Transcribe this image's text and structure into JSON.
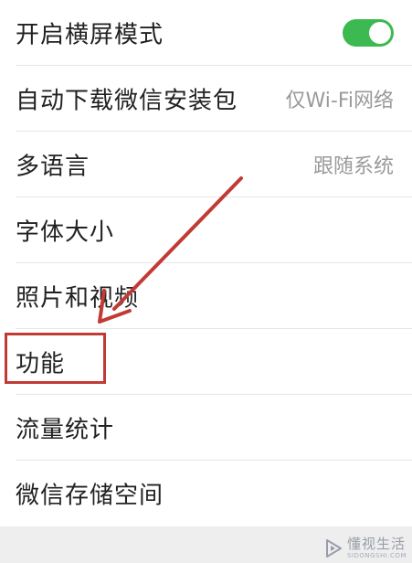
{
  "settings": {
    "items": [
      {
        "label": "开启横屏模式",
        "value": "",
        "control": "toggle",
        "toggle_on": true
      },
      {
        "label": "自动下载微信安装包",
        "value": "仅Wi-Fi网络",
        "control": "value"
      },
      {
        "label": "多语言",
        "value": "跟随系统",
        "control": "value"
      },
      {
        "label": "字体大小",
        "value": "",
        "control": "none"
      },
      {
        "label": "照片和视频",
        "value": "",
        "control": "none"
      },
      {
        "label": "功能",
        "value": "",
        "control": "none",
        "highlighted": true
      },
      {
        "label": "流量统计",
        "value": "",
        "control": "none"
      },
      {
        "label": "微信存储空间",
        "value": "",
        "control": "none"
      }
    ]
  },
  "annotation": {
    "arrow_color": "#c23a34",
    "highlight_color": "#c23a34",
    "points_to": "功能"
  },
  "watermark": {
    "main": "懂视生活",
    "sub": "SIDONGSHI.COM"
  },
  "colors": {
    "toggle_on": "#3cb950",
    "text": "#222222",
    "secondary_text": "#9a9a9a",
    "divider": "#e6e6e6",
    "footer_bg": "#eeeeee"
  },
  "icons": {
    "toggle": "toggle-switch-icon",
    "arrow": "arrow-annotation-icon",
    "watermark_logo": "play-triangle-logo-icon"
  }
}
